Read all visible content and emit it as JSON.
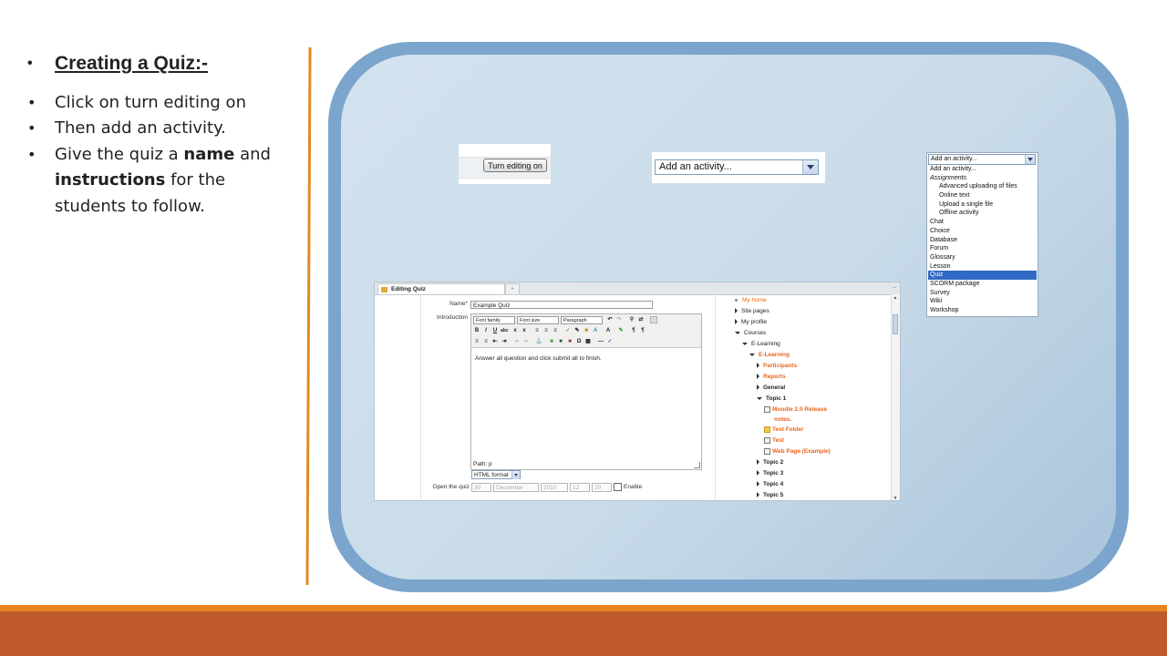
{
  "slide": {
    "heading": "Creating a Quiz:-",
    "bullet_1": "Click on turn editing on",
    "bullet_2": "Then add an activity.",
    "bullet_3_pre": "Give the quiz a ",
    "bullet_3_name": "name",
    "bullet_3_mid": " and ",
    "bullet_3_instr": "instructions",
    "bullet_3_post": " for the students to follow."
  },
  "shot_turn_editing": {
    "button_label": "Turn editing on"
  },
  "shot_add_activity": {
    "select_value": "Add an activity..."
  },
  "shot_activity_list": {
    "select_value": "Add an activity...",
    "options": [
      {
        "label": "Add an activity...",
        "kind": "normal"
      },
      {
        "label": "Assignments",
        "kind": "group"
      },
      {
        "label": "Advanced uploading of files",
        "kind": "indent"
      },
      {
        "label": "Online text",
        "kind": "indent"
      },
      {
        "label": "Upload a single file",
        "kind": "indent"
      },
      {
        "label": "Offline activity",
        "kind": "indent"
      },
      {
        "label": "Chat",
        "kind": "normal"
      },
      {
        "label": "Choice",
        "kind": "normal"
      },
      {
        "label": "Database",
        "kind": "normal"
      },
      {
        "label": "Forum",
        "kind": "normal"
      },
      {
        "label": "Glossary",
        "kind": "normal"
      },
      {
        "label": "Lesson",
        "kind": "normal"
      },
      {
        "label": "Quiz",
        "kind": "selected"
      },
      {
        "label": "SCORM package",
        "kind": "normal"
      },
      {
        "label": "Survey",
        "kind": "normal"
      },
      {
        "label": "Wiki",
        "kind": "normal"
      },
      {
        "label": "Workshop",
        "kind": "normal"
      }
    ]
  },
  "shot_editing_quiz": {
    "tab_title": "Editing Quiz",
    "new_tab": "+",
    "name_label": "Name*",
    "name_value": "Example Quiz",
    "intro_label": "Introduction",
    "font_family": "Font family",
    "font_size": "Font size",
    "paragraph": "Paragraph",
    "editor_text": "Answer all question and click submit all to finish.",
    "path": "Path: p",
    "format": "HTML format",
    "open_label": "Open the quiz",
    "day": "30",
    "month": "December",
    "year": "2010",
    "hour": "12",
    "minute": "20",
    "enable": "Enable",
    "tree": {
      "my_home": "My home",
      "site_pages": "Site pages",
      "my_profile": "My profile",
      "courses": "Courses",
      "elearning_parent": "E-Learning",
      "elearning": "E-Learning",
      "participants": "Participants",
      "reports": "Reports",
      "general": "General",
      "topic1": "Topic 1",
      "moodle_notes_1": "Moodle 2.0 Release",
      "moodle_notes_2": "notes.",
      "test_folder": "Test Folder",
      "test": "Test",
      "web_page": "Web Page (Example)",
      "topic2": "Topic 2",
      "topic3": "Topic 3",
      "topic4": "Topic 4",
      "topic5": "Topic 5"
    }
  },
  "colors": {
    "frame": "#7ba5cc",
    "accent_line": "#e08a22",
    "footer": "#bf5b2a",
    "footer_top": "#e8861f",
    "link_orange": "#e8651a",
    "select_highlight": "#316ac5"
  }
}
